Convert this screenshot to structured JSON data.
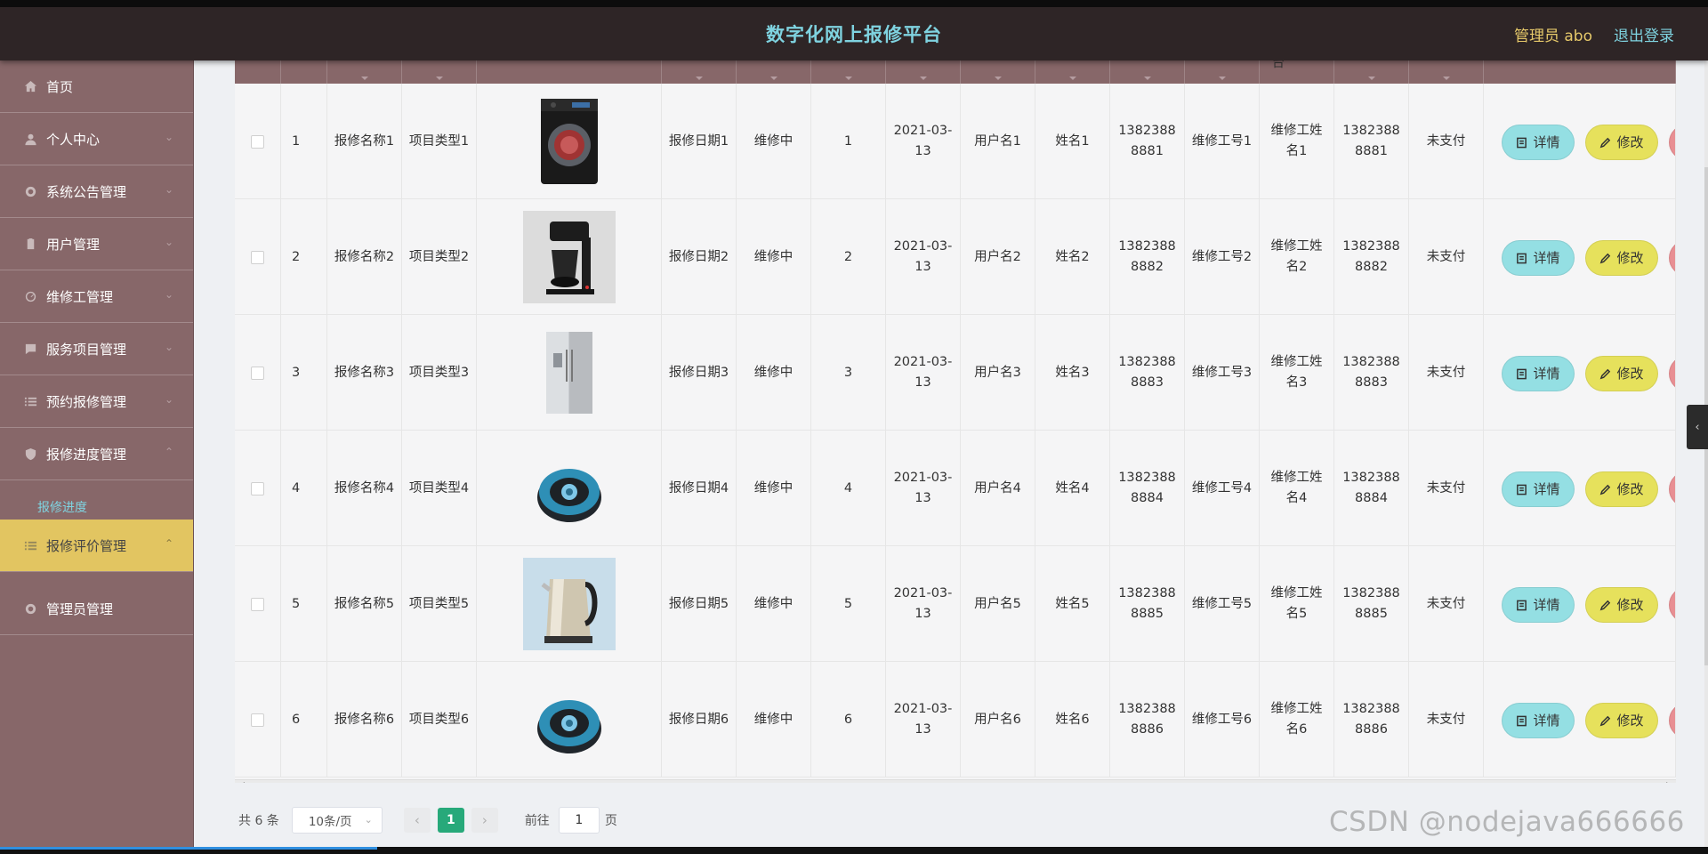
{
  "header": {
    "title": "数字化网上报修平台",
    "user": "管理员 abo",
    "logout": "退出登录"
  },
  "sidebar": {
    "items": [
      {
        "label": "首页",
        "icon": "home-icon",
        "chevron": ""
      },
      {
        "label": "个人中心",
        "icon": "user-icon",
        "chevron": "⌄"
      },
      {
        "label": "系统公告管理",
        "icon": "settings-icon",
        "chevron": "⌄"
      },
      {
        "label": "用户管理",
        "icon": "clipboard-icon",
        "chevron": "⌄"
      },
      {
        "label": "维修工管理",
        "icon": "gauge-icon",
        "chevron": "⌄"
      },
      {
        "label": "服务项目管理",
        "icon": "message-icon",
        "chevron": "⌄"
      },
      {
        "label": "预约报修管理",
        "icon": "list-icon",
        "chevron": "⌄"
      },
      {
        "label": "报修进度管理",
        "icon": "shield-icon",
        "chevron": "⌃"
      },
      {
        "label": "报修评价管理",
        "icon": "list-icon",
        "chevron": "⌃"
      },
      {
        "label": "管理员管理",
        "icon": "settings-icon",
        "chevron": ""
      }
    ],
    "sub_item": "报修进度"
  },
  "table": {
    "header_fragment": "台",
    "rows": [
      {
        "index": "1",
        "repair_name": "报修名称1",
        "item_type": "项目类型1",
        "image": "washing-machine-image",
        "repair_date": "报修日期1",
        "status": "维修中",
        "num": "1",
        "time": "2021-03-13",
        "username": "用户名1",
        "name": "姓名1",
        "phone": "13823888881",
        "worker_no": "维修工号1",
        "worker_name": "维修工姓名1",
        "worker_phone": "13823888881",
        "pay": "未支付"
      },
      {
        "index": "2",
        "repair_name": "报修名称2",
        "item_type": "项目类型2",
        "image": "coffee-maker-image",
        "repair_date": "报修日期2",
        "status": "维修中",
        "num": "2",
        "time": "2021-03-13",
        "username": "用户名2",
        "name": "姓名2",
        "phone": "13823888882",
        "worker_no": "维修工号2",
        "worker_name": "维修工姓名2",
        "worker_phone": "13823888882",
        "pay": "未支付"
      },
      {
        "index": "3",
        "repair_name": "报修名称3",
        "item_type": "项目类型3",
        "image": "refrigerator-image",
        "repair_date": "报修日期3",
        "status": "维修中",
        "num": "3",
        "time": "2021-03-13",
        "username": "用户名3",
        "name": "姓名3",
        "phone": "13823888883",
        "worker_no": "维修工号3",
        "worker_name": "维修工姓名3",
        "worker_phone": "13823888883",
        "pay": "未支付"
      },
      {
        "index": "4",
        "repair_name": "报修名称4",
        "item_type": "项目类型4",
        "image": "robot-vacuum-image",
        "repair_date": "报修日期4",
        "status": "维修中",
        "num": "4",
        "time": "2021-03-13",
        "username": "用户名4",
        "name": "姓名4",
        "phone": "13823888884",
        "worker_no": "维修工号4",
        "worker_name": "维修工姓名4",
        "worker_phone": "13823888884",
        "pay": "未支付"
      },
      {
        "index": "5",
        "repair_name": "报修名称5",
        "item_type": "项目类型5",
        "image": "kettle-image",
        "repair_date": "报修日期5",
        "status": "维修中",
        "num": "5",
        "time": "2021-03-13",
        "username": "用户名5",
        "name": "姓名5",
        "phone": "13823888885",
        "worker_no": "维修工号5",
        "worker_name": "维修工姓名5",
        "worker_phone": "13823888885",
        "pay": "未支付"
      },
      {
        "index": "6",
        "repair_name": "报修名称6",
        "item_type": "项目类型6",
        "image": "robot-vacuum-image",
        "repair_date": "报修日期6",
        "status": "维修中",
        "num": "6",
        "time": "2021-03-13",
        "username": "用户名6",
        "name": "姓名6",
        "phone": "13823888886",
        "worker_no": "维修工号6",
        "worker_name": "维修工姓名6",
        "worker_phone": "13823888886",
        "pay": "未支付"
      }
    ],
    "actions": {
      "detail": "详情",
      "edit": "修改"
    }
  },
  "pagination": {
    "total": "共 6 条",
    "page_size": "10条/页",
    "current": "1",
    "goto_label": "前往",
    "goto_value": "1",
    "page_unit": "页"
  },
  "watermark": "CSDN @nodejava666666",
  "colors": {
    "header_bg": "#2e2526",
    "sidebar_bg": "#876769",
    "active_item": "#e2c561",
    "detail_btn": "#94dfe3",
    "edit_btn": "#e6e15c",
    "delete_btn": "#e88f93",
    "pager_active": "#27a97a"
  }
}
